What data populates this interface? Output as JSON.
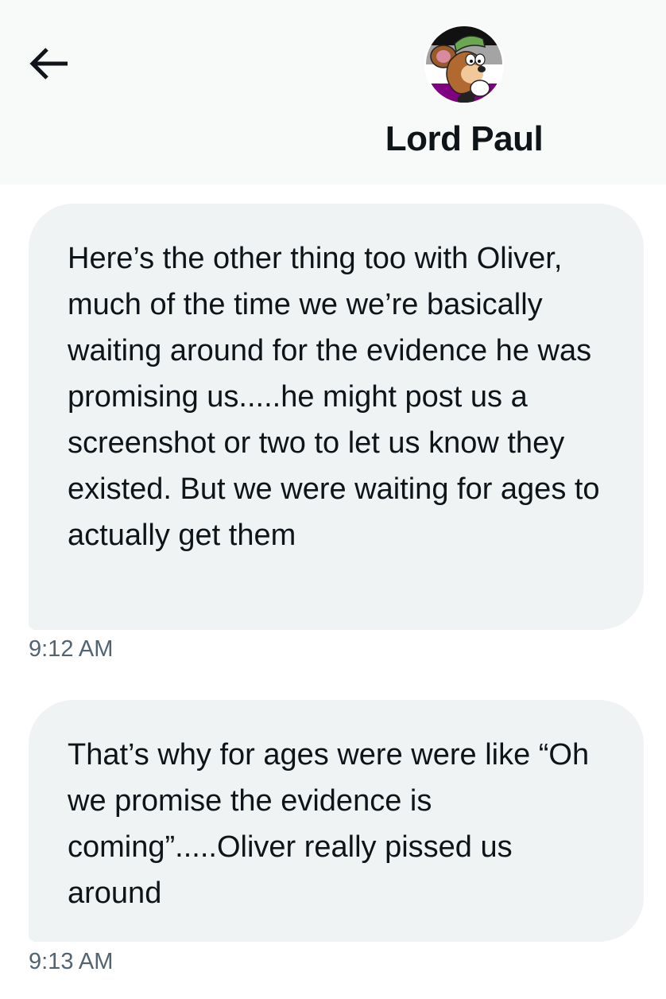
{
  "header": {
    "back_icon": "arrow-left-icon",
    "avatar_icon": "cartoon-avatar",
    "contact_name": "Lord Paul"
  },
  "messages": [
    {
      "text": "Here’s the other thing too with Oliver, much of the time we we’re basically waiting around for the evidence he was promising us.....he might post us a screenshot or two to let us know they existed. But we were waiting for ages to actually get them",
      "time": "9:12 AM"
    },
    {
      "text": "That’s why for ages were were like “Oh we promise the evidence is coming”.....Oliver really pissed us around",
      "time": "9:13 AM"
    }
  ],
  "colors": {
    "header_bg": "#f8f9f9",
    "bubble_bg": "#eff3f4",
    "text": "#0f1419",
    "secondary_text": "#536471"
  }
}
